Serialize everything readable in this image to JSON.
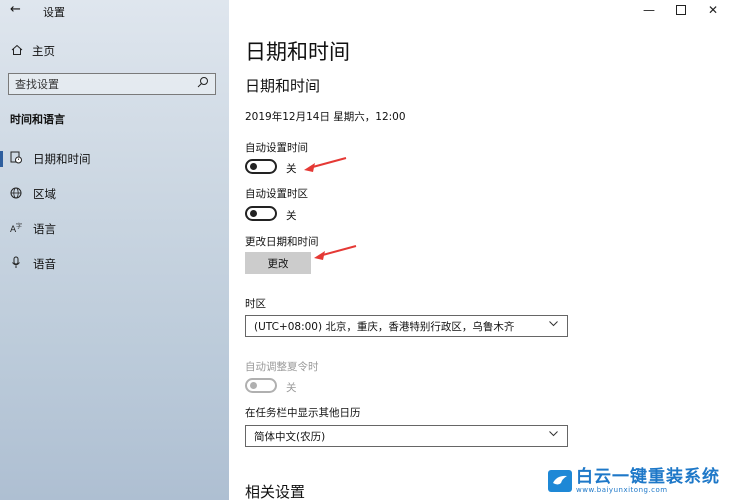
{
  "window": {
    "app_title": "设置",
    "back_icon": "back-arrow-icon",
    "controls": [
      "minimize-icon",
      "maximize-icon",
      "close-icon"
    ]
  },
  "sidebar": {
    "home_label": "主页",
    "search_placeholder": "查找设置",
    "section_heading": "时间和语言",
    "items": [
      {
        "label": "日期和时间",
        "icon": "calendar-clock-icon",
        "active": true
      },
      {
        "label": "区域",
        "icon": "globe-icon",
        "active": false
      },
      {
        "label": "语言",
        "icon": "language-icon",
        "active": false
      },
      {
        "label": "语音",
        "icon": "microphone-icon",
        "active": false
      }
    ]
  },
  "main": {
    "page_title": "日期和时间",
    "section_title": "日期和时间",
    "current_datetime": "2019年12月14日 星期六，12:00",
    "auto_time": {
      "label": "自动设置时间",
      "state_text": "关",
      "on": false
    },
    "auto_timezone": {
      "label": "自动设置时区",
      "state_text": "关",
      "on": false
    },
    "change_datetime": {
      "label": "更改日期和时间",
      "button": "更改"
    },
    "timezone": {
      "label": "时区",
      "value": "(UTC+08:00) 北京，重庆，香港特别行政区，乌鲁木齐"
    },
    "dst": {
      "label": "自动调整夏令时",
      "state_text": "关",
      "on": false,
      "disabled": true
    },
    "extra_calendar": {
      "label": "在任务栏中显示其他日历",
      "value": "简体中文(农历)"
    },
    "related_title": "相关设置"
  },
  "annotations": {
    "arrow_color": "#e53935"
  },
  "watermark": {
    "name": "白云一键重装系统",
    "url": "www.baiyunxitong.com",
    "color": "#1e78c8"
  },
  "colors": {
    "accent": "#2f5f9e",
    "sidebar_top": "#dfe6ee",
    "sidebar_bottom": "#aebfd2",
    "button_bg": "#cccccc"
  }
}
